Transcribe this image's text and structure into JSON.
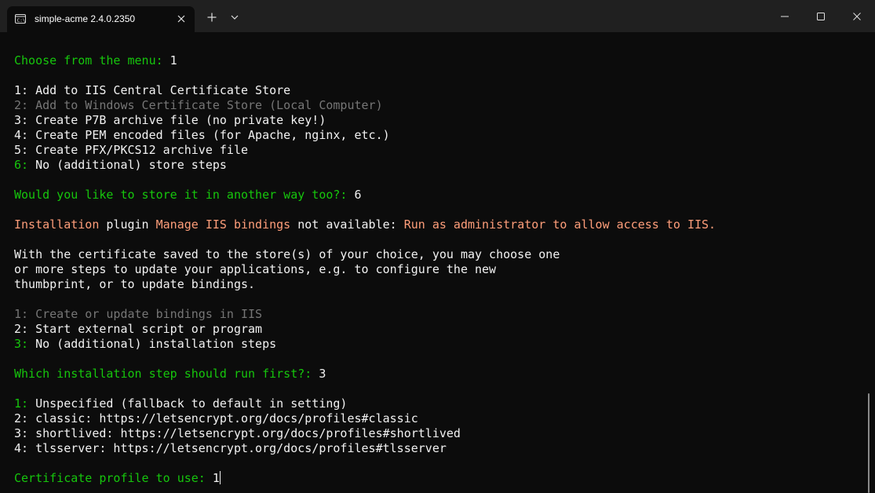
{
  "window": {
    "tab_title": "simple-acme 2.4.0.2350"
  },
  "icons": {
    "tab": "terminal-icon",
    "tab_close": "close-icon",
    "new_tab": "plus-icon",
    "dropdown": "chevron-down-icon",
    "minimize": "minimize-icon",
    "maximize": "maximize-icon",
    "close": "close-icon"
  },
  "colors": {
    "background": "#0c0c0c",
    "titlebar": "#202020",
    "prompt_green": "#16c60c",
    "warning_salmon": "#ff9e7a",
    "disabled_gray": "#767676",
    "text": "#cccccc"
  },
  "terminal": {
    "q1": {
      "prompt": "Choose from the menu:",
      "answer": " 1"
    },
    "store_options": [
      {
        "num": "1:",
        "text": " Add to IIS Central Certificate Store"
      },
      {
        "num": "2:",
        "text": " Add to Windows Certificate Store (Local Computer)"
      },
      {
        "num": "3:",
        "text": " Create P7B archive file (no private key!)"
      },
      {
        "num": "4:",
        "text": " Create PEM encoded files (for Apache, nginx, etc.)"
      },
      {
        "num": "5:",
        "text": " Create PFX/PKCS12 archive file"
      },
      {
        "num": "6:",
        "text": " No (additional) store steps"
      }
    ],
    "q2": {
      "prompt": "Would you like to store it in another way too?:",
      "answer": " 6"
    },
    "install_warning": {
      "p1": "Installation",
      "p2": " plugin ",
      "p3": "Manage IIS bindings",
      "p4": " not available: ",
      "p5": "Run as administrator to allow access to IIS."
    },
    "paragraph": [
      "With the certificate saved to the store(s) of your choice, you may choose one",
      "or more steps to update your applications, e.g. to configure the new",
      "thumbprint, or to update bindings."
    ],
    "install_options": [
      {
        "num": "1:",
        "text": " Create or update bindings in IIS"
      },
      {
        "num": "2:",
        "text": " Start external script or program"
      },
      {
        "num": "3:",
        "text": " No (additional) installation steps"
      }
    ],
    "q3": {
      "prompt": "Which installation step should run first?:",
      "answer": " 3"
    },
    "profile_options": [
      {
        "num": "1:",
        "text": " Unspecified (fallback to default in setting)"
      },
      {
        "num": "2:",
        "text": " classic: https://letsencrypt.org/docs/profiles#classic"
      },
      {
        "num": "3:",
        "text": " shortlived: https://letsencrypt.org/docs/profiles#shortlived"
      },
      {
        "num": "4:",
        "text": " tlsserver: https://letsencrypt.org/docs/profiles#tlsserver"
      }
    ],
    "q4": {
      "prompt": "Certificate profile to use:",
      "answer": " 1"
    }
  }
}
